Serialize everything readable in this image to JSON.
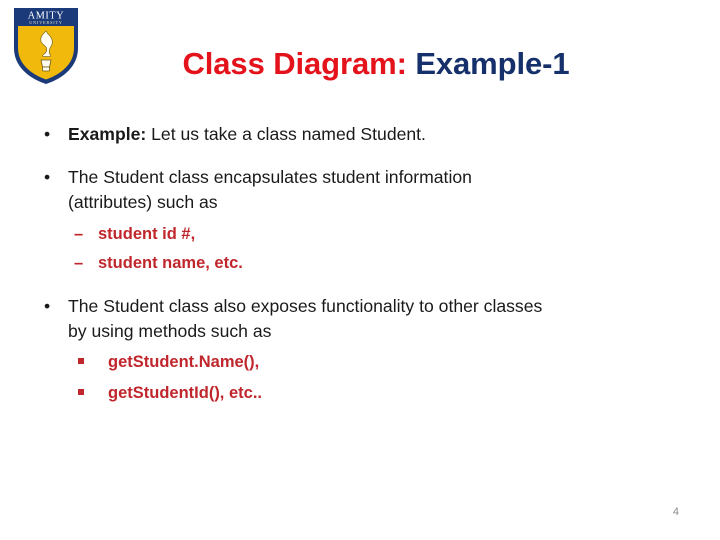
{
  "slide": {
    "logo": {
      "name": "amity-university-logo",
      "primary_text": "AMITY",
      "secondary_text": "UNIVERSITY",
      "shield_top_color": "#1B3A7A",
      "shield_body_color": "#F0B90B",
      "flame_color": "#FFFDF2"
    },
    "title": {
      "part1": "Class Diagram:",
      "part2": "Example-1",
      "part1_color": "#E4121B",
      "part2_color": "#15306B"
    },
    "bullets": [
      {
        "marker": "•",
        "level": 1,
        "bold_lead": "Example:",
        "text": " Let us take a class named Student."
      },
      {
        "marker": "•",
        "level": 1,
        "line1": "The Student class encapsulates student information",
        "line2": "(attributes) such as"
      },
      {
        "marker": "–",
        "level": 2,
        "text": "student id #,"
      },
      {
        "marker": "–",
        "level": 2,
        "text": "student name, etc."
      },
      {
        "marker": "•",
        "level": 1,
        "line1": "The Student class also exposes functionality to other classes",
        "line2": "by using methods such as"
      },
      {
        "marker": "square",
        "level": 2,
        "text": "getStudent.Name(),"
      },
      {
        "marker": "square",
        "level": 2,
        "text": "getStudentId(), etc.."
      }
    ],
    "page_number": "4"
  }
}
